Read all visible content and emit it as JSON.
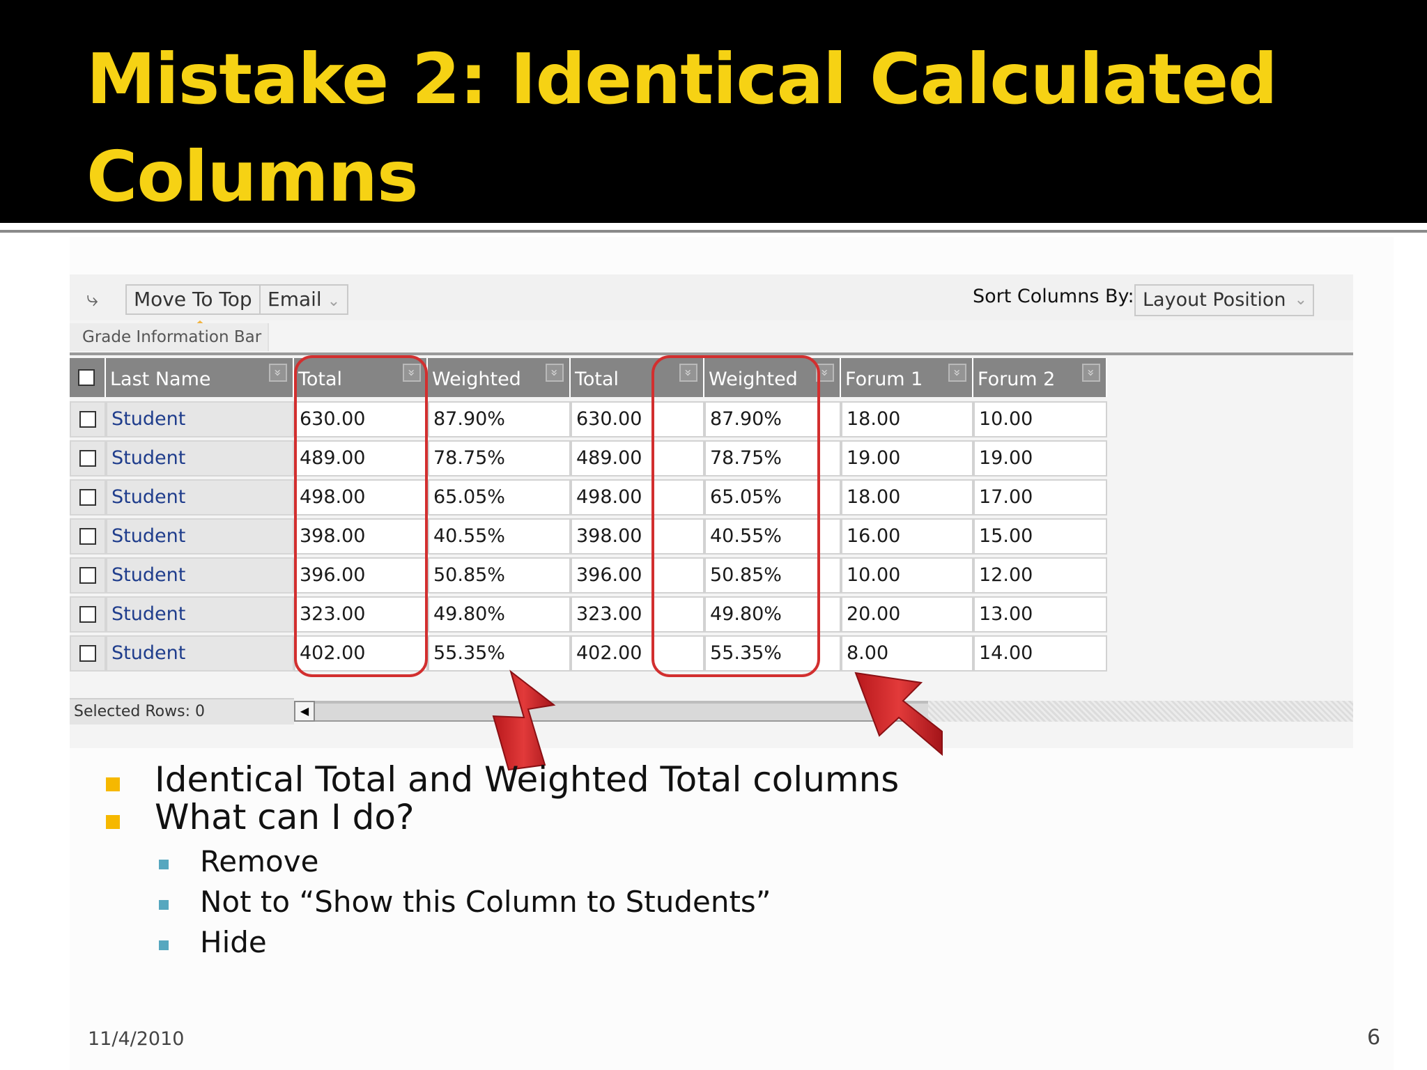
{
  "slide": {
    "title": "Mistake 2: Identical Calculated Columns",
    "date": "11/4/2010",
    "page_number": "6"
  },
  "toolbar": {
    "move_to_top_label": "Move To Top",
    "email_label": "Email",
    "sort_label": "Sort Columns By:",
    "sort_value": "Layout Position",
    "grade_info_bar_label": "Grade Information Bar"
  },
  "grid": {
    "columns": [
      "Last Name",
      "Total",
      "Weighted Total",
      "Total",
      "Weighted Total",
      "Forum 1",
      "Forum 2"
    ],
    "rows": [
      [
        "Student",
        "630.00",
        "87.90%",
        "630.00",
        "87.90%",
        "18.00",
        "10.00"
      ],
      [
        "Student",
        "489.00",
        "78.75%",
        "489.00",
        "78.75%",
        "19.00",
        "19.00"
      ],
      [
        "Student",
        "498.00",
        "65.05%",
        "498.00",
        "65.05%",
        "18.00",
        "17.00"
      ],
      [
        "Student",
        "398.00",
        "40.55%",
        "398.00",
        "40.55%",
        "16.00",
        "15.00"
      ],
      [
        "Student",
        "396.00",
        "50.85%",
        "396.00",
        "50.85%",
        "10.00",
        "12.00"
      ],
      [
        "Student",
        "323.00",
        "49.80%",
        "323.00",
        "49.80%",
        "20.00",
        "13.00"
      ],
      [
        "Student",
        "402.00",
        "55.35%",
        "402.00",
        "55.35%",
        "8.00",
        "14.00"
      ]
    ],
    "selected_rows_label": "Selected Rows: 0"
  },
  "bullets": {
    "level1": [
      "Identical Total and Weighted Total columns",
      "What can I do?"
    ],
    "level2": [
      "Remove",
      "Not to “Show this Column to Students”",
      "Hide"
    ]
  },
  "icons": {
    "toolbar_arrow": "arrow-right-icon",
    "column_menu": "double-chevron-down-icon",
    "scroll_left": "scroll-left-arrow-icon"
  },
  "colors": {
    "title_text": "#f6d214",
    "title_background": "#000000",
    "highlight": "#d22f2f",
    "header_background": "#858585",
    "name_link": "#1f3d8c",
    "bullet_l1": "#f6b800",
    "bullet_l2": "#56a7bf"
  }
}
